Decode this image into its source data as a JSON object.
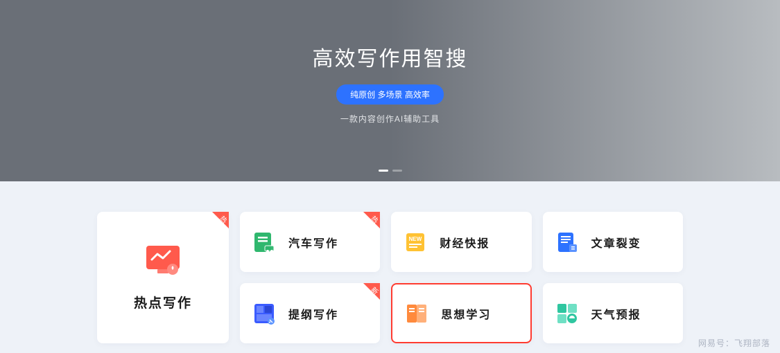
{
  "hero": {
    "title": "高效写作用智搜",
    "badge": "纯原创 多场景 高效率",
    "subtitle": "一款内容创作AI辅助工具"
  },
  "big_card": {
    "label": "热点写作",
    "corner": "热"
  },
  "cards": [
    {
      "label": "汽车写作",
      "corner": "热",
      "icon": "car-doc-icon",
      "color": "#2fb76e"
    },
    {
      "label": "财经快报",
      "corner": "",
      "icon": "news-icon",
      "color": "#ffc233"
    },
    {
      "label": "文章裂变",
      "corner": "",
      "icon": "split-doc-icon",
      "color": "#2d72ff"
    },
    {
      "label": "提纲写作",
      "corner": "新",
      "icon": "outline-icon",
      "color": "#3a5bff"
    },
    {
      "label": "思想学习",
      "corner": "",
      "icon": "book-icon",
      "color": "#ff8a3d",
      "selected": true
    },
    {
      "label": "天气预报",
      "corner": "",
      "icon": "weather-icon",
      "color": "#2fc6a0"
    }
  ],
  "watermark": "网易号：飞翔部落"
}
